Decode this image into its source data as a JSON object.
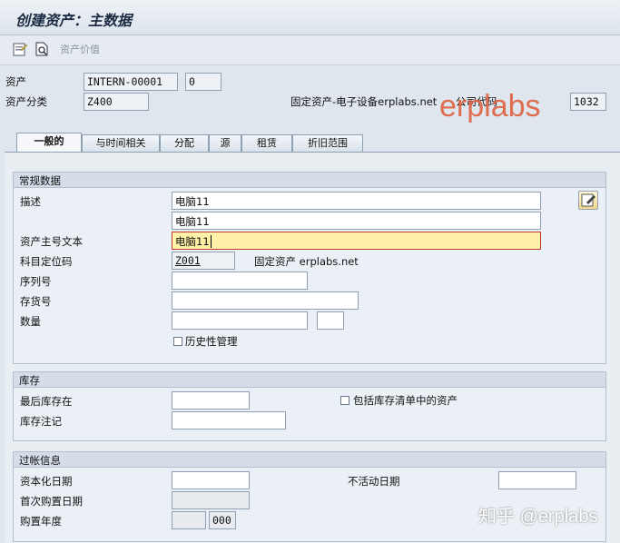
{
  "window": {
    "title": "创建资产：主数据"
  },
  "toolbar": {
    "asset_value_label": "资产价值"
  },
  "header": {
    "asset_label": "资产",
    "asset_number": "INTERN-00001",
    "asset_subnumber": "0",
    "asset_class_label": "资产分类",
    "asset_class": "Z400",
    "asset_class_desc": "固定资产-电子设备erplabs.net",
    "company_code_label": "公司代码",
    "company_code": "1032"
  },
  "tabs": [
    {
      "label": "一般的"
    },
    {
      "label": "与时间相关"
    },
    {
      "label": "分配"
    },
    {
      "label": "源"
    },
    {
      "label": "租赁"
    },
    {
      "label": "折旧范围"
    }
  ],
  "general": {
    "title": "常规数据",
    "description_label": "描述",
    "description1": "电脑11",
    "description2": "电脑11",
    "main_text_label": "资产主号文本",
    "main_text": "电脑11",
    "account_determination_label": "科目定位码",
    "account_determination": "Z001",
    "account_determination_desc": "固定资产 erplabs.net",
    "serial_label": "序列号",
    "serial": "",
    "inventory_label": "存货号",
    "inventory": "",
    "quantity_label": "数量",
    "quantity": "",
    "unit": "",
    "history_label": "历史性管理"
  },
  "inventory": {
    "title": "库存",
    "last_inventory_label": "最后库存在",
    "last_inventory": "",
    "include_label": "包括库存清单中的资产",
    "note_label": "库存注记",
    "note": ""
  },
  "posting": {
    "title": "过帐信息",
    "cap_date_label": "资本化日期",
    "cap_date": "",
    "deactivation_label": "不活动日期",
    "deactivation": "",
    "first_acq_label": "首次购置日期",
    "first_acq": "",
    "acq_year_label": "购置年度",
    "acq_year": "",
    "acq_period": "000"
  },
  "watermarks": {
    "red": "erplabs",
    "bottom": "知乎 @erplabs"
  }
}
